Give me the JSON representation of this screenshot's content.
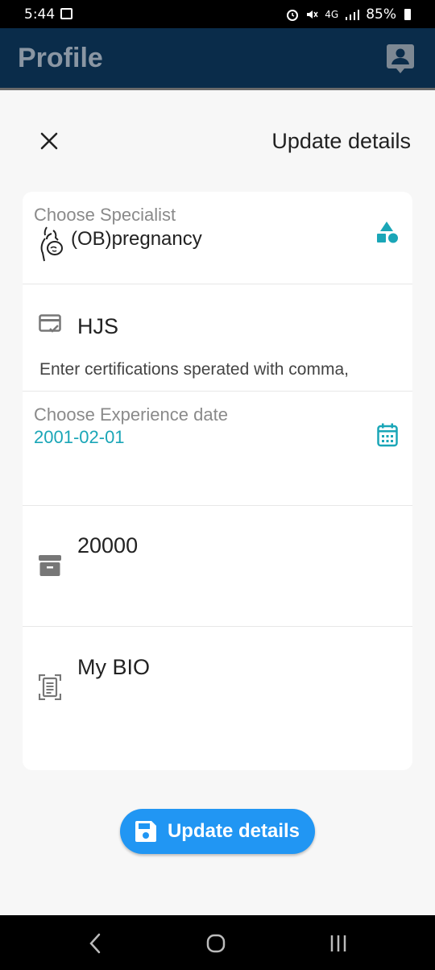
{
  "status_bar": {
    "time": "5:44",
    "network": "4G",
    "battery": "85%"
  },
  "app_bar": {
    "title": "Profile",
    "profile_icon": "account-box-icon"
  },
  "sheet_header": {
    "close_icon": "close-icon",
    "title": "Update details"
  },
  "form": {
    "specialist": {
      "label": "Choose Specialist",
      "value": "(OB)pregnancy",
      "icon": "pregnancy-icon",
      "trailing_icon": "shapes-icon"
    },
    "certifications": {
      "value": "HJS",
      "hint": "Enter certifications sperated with comma,",
      "icon": "certificate-icon"
    },
    "experience": {
      "label": "Choose Experience date",
      "value": "2001-02-01",
      "icon": "calendar-icon"
    },
    "price": {
      "value": "20000",
      "icon": "archive-box-icon"
    },
    "bio": {
      "value": "My BIO",
      "icon": "document-icon"
    }
  },
  "update_button": {
    "label": "Update details",
    "icon": "save-icon"
  },
  "colors": {
    "app_bar": "#0a2c4a",
    "accent_teal": "#1aa6b7",
    "button_blue": "#2196f3"
  }
}
